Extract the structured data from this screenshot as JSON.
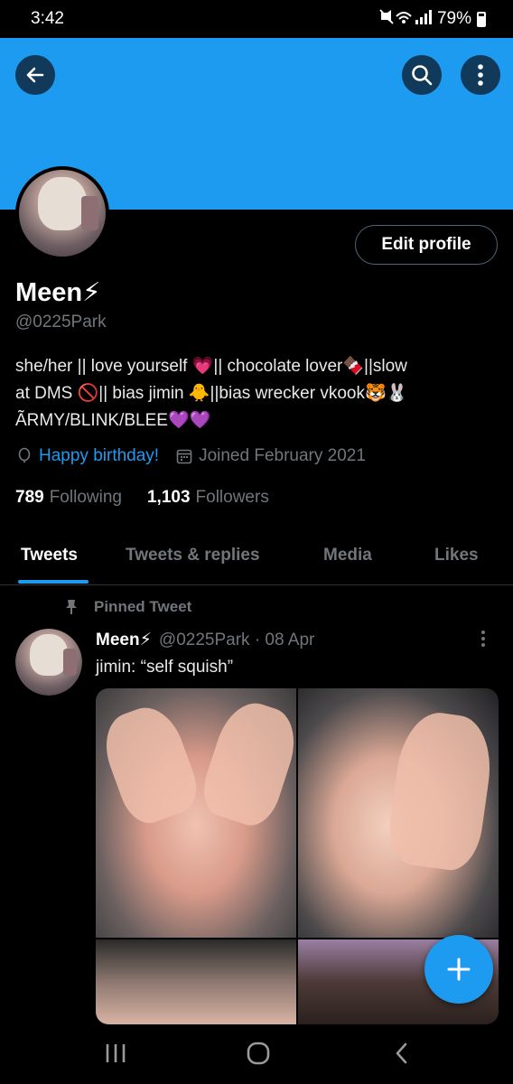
{
  "status_bar": {
    "time": "3:42",
    "battery": "79%"
  },
  "header": {
    "back_icon": "back-arrow-icon",
    "search_icon": "search-icon",
    "more_icon": "more-vertical-icon",
    "banner_color": "#1d9bf0"
  },
  "profile": {
    "edit_label": "Edit profile",
    "display_name": "Meen⚡",
    "handle": "@0225Park",
    "bio_line1": "she/her || love yourself 💗|| chocolate lover🍫||slow",
    "bio_line2": "at DMS 🚫|| bias jimin 🐥||bias wrecker vkook🐯🐰",
    "bio_line3": "ÃRMY/BLINK/BLEE💜💜",
    "birthday": "Happy birthday!",
    "joined": "Joined February 2021",
    "following_count": "789",
    "following_label": "Following",
    "followers_count": "1,103",
    "followers_label": "Followers"
  },
  "tabs": [
    {
      "label": "Tweets",
      "active": true
    },
    {
      "label": "Tweets & replies"
    },
    {
      "label": "Media"
    },
    {
      "label": "Likes"
    }
  ],
  "tweet": {
    "pinned_label": "Pinned Tweet",
    "author": "Meen⚡",
    "meta": "@0225Park · 08 Apr",
    "text": "jimin: “self squish”"
  },
  "colors": {
    "accent": "#1d9bf0",
    "background": "#000000",
    "muted": "#71767b"
  }
}
